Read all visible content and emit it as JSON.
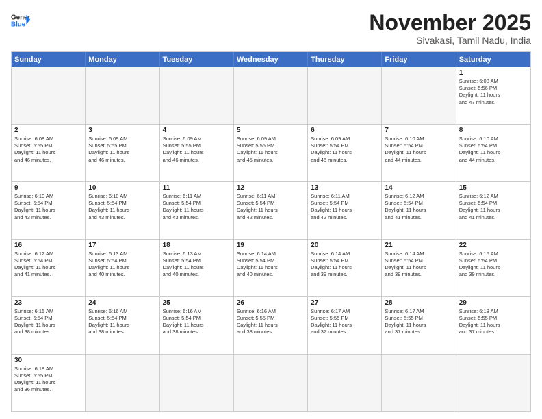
{
  "logo": {
    "line1": "General",
    "line2": "Blue"
  },
  "title": "November 2025",
  "subtitle": "Sivakasi, Tamil Nadu, India",
  "header_days": [
    "Sunday",
    "Monday",
    "Tuesday",
    "Wednesday",
    "Thursday",
    "Friday",
    "Saturday"
  ],
  "weeks": [
    [
      {
        "day": "",
        "text": ""
      },
      {
        "day": "",
        "text": ""
      },
      {
        "day": "",
        "text": ""
      },
      {
        "day": "",
        "text": ""
      },
      {
        "day": "",
        "text": ""
      },
      {
        "day": "",
        "text": ""
      },
      {
        "day": "1",
        "text": "Sunrise: 6:08 AM\nSunset: 5:56 PM\nDaylight: 11 hours\nand 47 minutes."
      }
    ],
    [
      {
        "day": "2",
        "text": "Sunrise: 6:08 AM\nSunset: 5:55 PM\nDaylight: 11 hours\nand 46 minutes."
      },
      {
        "day": "3",
        "text": "Sunrise: 6:09 AM\nSunset: 5:55 PM\nDaylight: 11 hours\nand 46 minutes."
      },
      {
        "day": "4",
        "text": "Sunrise: 6:09 AM\nSunset: 5:55 PM\nDaylight: 11 hours\nand 46 minutes."
      },
      {
        "day": "5",
        "text": "Sunrise: 6:09 AM\nSunset: 5:55 PM\nDaylight: 11 hours\nand 45 minutes."
      },
      {
        "day": "6",
        "text": "Sunrise: 6:09 AM\nSunset: 5:54 PM\nDaylight: 11 hours\nand 45 minutes."
      },
      {
        "day": "7",
        "text": "Sunrise: 6:10 AM\nSunset: 5:54 PM\nDaylight: 11 hours\nand 44 minutes."
      },
      {
        "day": "8",
        "text": "Sunrise: 6:10 AM\nSunset: 5:54 PM\nDaylight: 11 hours\nand 44 minutes."
      }
    ],
    [
      {
        "day": "9",
        "text": "Sunrise: 6:10 AM\nSunset: 5:54 PM\nDaylight: 11 hours\nand 43 minutes."
      },
      {
        "day": "10",
        "text": "Sunrise: 6:10 AM\nSunset: 5:54 PM\nDaylight: 11 hours\nand 43 minutes."
      },
      {
        "day": "11",
        "text": "Sunrise: 6:11 AM\nSunset: 5:54 PM\nDaylight: 11 hours\nand 43 minutes."
      },
      {
        "day": "12",
        "text": "Sunrise: 6:11 AM\nSunset: 5:54 PM\nDaylight: 11 hours\nand 42 minutes."
      },
      {
        "day": "13",
        "text": "Sunrise: 6:11 AM\nSunset: 5:54 PM\nDaylight: 11 hours\nand 42 minutes."
      },
      {
        "day": "14",
        "text": "Sunrise: 6:12 AM\nSunset: 5:54 PM\nDaylight: 11 hours\nand 41 minutes."
      },
      {
        "day": "15",
        "text": "Sunrise: 6:12 AM\nSunset: 5:54 PM\nDaylight: 11 hours\nand 41 minutes."
      }
    ],
    [
      {
        "day": "16",
        "text": "Sunrise: 6:12 AM\nSunset: 5:54 PM\nDaylight: 11 hours\nand 41 minutes."
      },
      {
        "day": "17",
        "text": "Sunrise: 6:13 AM\nSunset: 5:54 PM\nDaylight: 11 hours\nand 40 minutes."
      },
      {
        "day": "18",
        "text": "Sunrise: 6:13 AM\nSunset: 5:54 PM\nDaylight: 11 hours\nand 40 minutes."
      },
      {
        "day": "19",
        "text": "Sunrise: 6:14 AM\nSunset: 5:54 PM\nDaylight: 11 hours\nand 40 minutes."
      },
      {
        "day": "20",
        "text": "Sunrise: 6:14 AM\nSunset: 5:54 PM\nDaylight: 11 hours\nand 39 minutes."
      },
      {
        "day": "21",
        "text": "Sunrise: 6:14 AM\nSunset: 5:54 PM\nDaylight: 11 hours\nand 39 minutes."
      },
      {
        "day": "22",
        "text": "Sunrise: 6:15 AM\nSunset: 5:54 PM\nDaylight: 11 hours\nand 39 minutes."
      }
    ],
    [
      {
        "day": "23",
        "text": "Sunrise: 6:15 AM\nSunset: 5:54 PM\nDaylight: 11 hours\nand 38 minutes."
      },
      {
        "day": "24",
        "text": "Sunrise: 6:16 AM\nSunset: 5:54 PM\nDaylight: 11 hours\nand 38 minutes."
      },
      {
        "day": "25",
        "text": "Sunrise: 6:16 AM\nSunset: 5:54 PM\nDaylight: 11 hours\nand 38 minutes."
      },
      {
        "day": "26",
        "text": "Sunrise: 6:16 AM\nSunset: 5:55 PM\nDaylight: 11 hours\nand 38 minutes."
      },
      {
        "day": "27",
        "text": "Sunrise: 6:17 AM\nSunset: 5:55 PM\nDaylight: 11 hours\nand 37 minutes."
      },
      {
        "day": "28",
        "text": "Sunrise: 6:17 AM\nSunset: 5:55 PM\nDaylight: 11 hours\nand 37 minutes."
      },
      {
        "day": "29",
        "text": "Sunrise: 6:18 AM\nSunset: 5:55 PM\nDaylight: 11 hours\nand 37 minutes."
      }
    ],
    [
      {
        "day": "30",
        "text": "Sunrise: 6:18 AM\nSunset: 5:55 PM\nDaylight: 11 hours\nand 36 minutes."
      },
      {
        "day": "",
        "text": ""
      },
      {
        "day": "",
        "text": ""
      },
      {
        "day": "",
        "text": ""
      },
      {
        "day": "",
        "text": ""
      },
      {
        "day": "",
        "text": ""
      },
      {
        "day": "",
        "text": ""
      }
    ]
  ]
}
